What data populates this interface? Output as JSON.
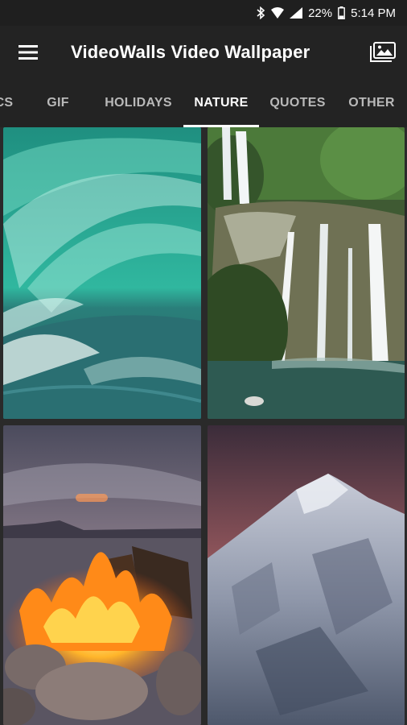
{
  "status": {
    "battery_percent": "22%",
    "time": "5:14 PM"
  },
  "appbar": {
    "title": "VideoWalls Video Wallpaper"
  },
  "tabs": [
    {
      "label": "CS"
    },
    {
      "label": "GIF"
    },
    {
      "label": "HOLIDAYS"
    },
    {
      "label": "NATURE",
      "active": true
    },
    {
      "label": "QUOTES"
    },
    {
      "label": "OTHER"
    }
  ],
  "colors": {
    "statusbar": "#1f1f1f",
    "appbar": "#232323",
    "background": "#1c1c1c",
    "tab_active": "#ffffff",
    "tab_inactive": "#b9b9b9"
  },
  "wallpapers": [
    {
      "icon": "waterfall-turquoise-thumbnail"
    },
    {
      "icon": "jungle-waterfall-thumbnail"
    },
    {
      "icon": "campfire-lake-thumbnail"
    },
    {
      "icon": "snowy-mountain-thumbnail"
    }
  ]
}
